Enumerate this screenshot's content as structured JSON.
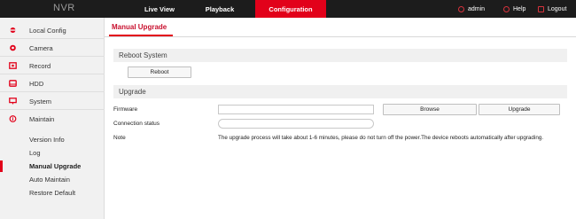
{
  "header": {
    "logo": "NVR",
    "nav": [
      "Live View",
      "Playback",
      "Configuration"
    ],
    "admin": "admin",
    "help": "Help",
    "logout": "Logout"
  },
  "sidebar": {
    "items": [
      "Local Config",
      "Camera",
      "Record",
      "HDD",
      "System",
      "Maintain"
    ],
    "sub_items": [
      "Version Info",
      "Log",
      "Manual Upgrade",
      "Auto Maintain",
      "Restore Default"
    ]
  },
  "main": {
    "tab": "Manual Upgrade",
    "reboot_section": "Reboot System",
    "reboot_button": "Reboot",
    "upgrade_section": "Upgrade",
    "firmware_label": "Firmware",
    "connection_label": "Connection status",
    "note_label": "Note",
    "browse_button": "Browse",
    "upgrade_button": "Upgrade",
    "note_text": "The upgrade process will take about 1-6 minutes, please do not turn off the power.The device reboots automatically after upgrading."
  },
  "colors": {
    "accent": "#e2011a",
    "topbar": "#1c1c1c",
    "sidebar": "#f1f1f1"
  }
}
